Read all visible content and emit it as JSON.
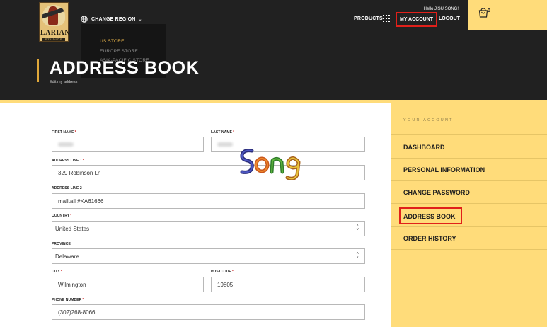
{
  "brand": {
    "logo_text": "LARIAN",
    "logo_subtext": "STUDIOS"
  },
  "header": {
    "change_region_label": "CHANGE REGION",
    "region_options": [
      "US STORE",
      "EUROPE STORE",
      "ASIA-PACIFIC STORE"
    ],
    "page_title": "ADDRESS BOOK",
    "page_subtitle": "Edit my address",
    "greeting": "Hello JISU SONG!",
    "nav": {
      "products": "PRODUCTS",
      "my_account": "MY ACCOUNT",
      "logout": "LOGOUT"
    },
    "cart_count": "0"
  },
  "form": {
    "first_name_label": "FIRST NAME",
    "last_name_label": "LAST NAME",
    "address1_label": "ADDRESS LINE 1",
    "address1_value": "329 Robinson Ln",
    "address2_label": "ADDRESS LINE 2",
    "address2_value": "malltail #KA61666",
    "country_label": "COUNTRY",
    "country_value": "United States",
    "province_label": "PROVINCE",
    "province_value": "Delaware",
    "city_label": "CITY",
    "city_value": "Wilmington",
    "postcode_label": "POSTCODE",
    "postcode_value": "19805",
    "phone_label": "PHONE NUMBER",
    "phone_value": "(302)268-8066",
    "required_marker": "*"
  },
  "signature_text": "Song",
  "sidebar": {
    "heading": "YOUR ACCOUNT",
    "items": [
      "DASHBOARD",
      "PERSONAL INFORMATION",
      "CHANGE PASSWORD",
      "ADDRESS BOOK",
      "ORDER HISTORY"
    ]
  },
  "colors": {
    "header_bg": "#212121",
    "accent_yellow": "#ffdc7a",
    "highlight_red": "#e0201a",
    "active_region": "#e7b44a"
  }
}
